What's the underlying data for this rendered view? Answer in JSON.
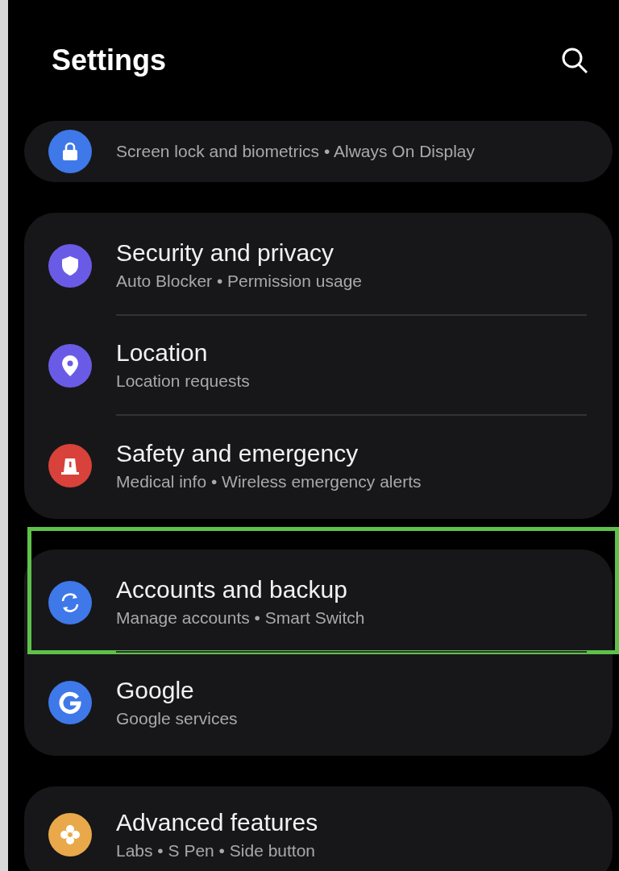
{
  "header": {
    "title": "Settings"
  },
  "groups": [
    {
      "items": [
        {
          "kind": "lock",
          "color": "#3f78e8",
          "subtitle": "Screen lock and biometrics • Always On Display",
          "highlighted": false
        }
      ]
    },
    {
      "items": [
        {
          "kind": "shield",
          "color": "#6a5be6",
          "title": "Security and privacy",
          "subtitle": "Auto Blocker • Permission usage",
          "highlighted": false
        },
        {
          "kind": "pin",
          "color": "#6a5be6",
          "title": "Location",
          "subtitle": "Location requests",
          "highlighted": false
        },
        {
          "kind": "siren",
          "color": "#d8423a",
          "title": "Safety and emergency",
          "subtitle": "Medical info • Wireless emergency alerts",
          "highlighted": false
        }
      ]
    },
    {
      "items": [
        {
          "kind": "sync",
          "color": "#3f78e8",
          "title": "Accounts and backup",
          "subtitle": "Manage accounts • Smart Switch",
          "highlighted": true
        },
        {
          "kind": "g",
          "color": "#3f78e8",
          "title": "Google",
          "subtitle": "Google services",
          "highlighted": false
        }
      ]
    },
    {
      "items": [
        {
          "kind": "flower",
          "color": "#e9a94a",
          "title": "Advanced features",
          "subtitle": "Labs • S Pen • Side button",
          "highlighted": false
        }
      ]
    }
  ]
}
